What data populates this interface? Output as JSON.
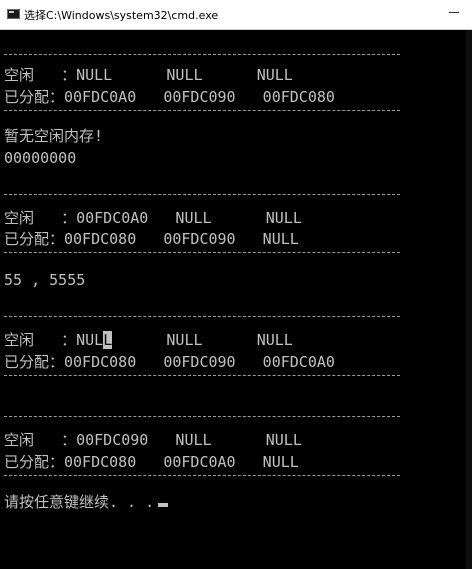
{
  "window": {
    "title": "选择C:\\Windows\\system32\\cmd.exe"
  },
  "console": {
    "block1": {
      "free": "空闲   ：NULL      NULL      NULL",
      "alloc": "已分配：00FDC0A0   00FDC090   00FDC080"
    },
    "no_free_msg": "暂无空闲内存!",
    "zero_line": "00000000",
    "block2": {
      "free": "空闲   ：00FDC0A0   NULL      NULL",
      "alloc": "已分配：00FDC080   00FDC090   NULL"
    },
    "numbers_line": "55 , 5555",
    "block3": {
      "free_a": "空闲   ：NUL",
      "free_hl": "L",
      "free_b": "      NULL      NULL",
      "alloc": "已分配：00FDC080   00FDC090   00FDC0A0"
    },
    "block4": {
      "free": "空闲   ：00FDC090   NULL      NULL",
      "alloc": "已分配：00FDC080   00FDC0A0   NULL"
    },
    "prompt": "请按任意键继续. . ."
  }
}
